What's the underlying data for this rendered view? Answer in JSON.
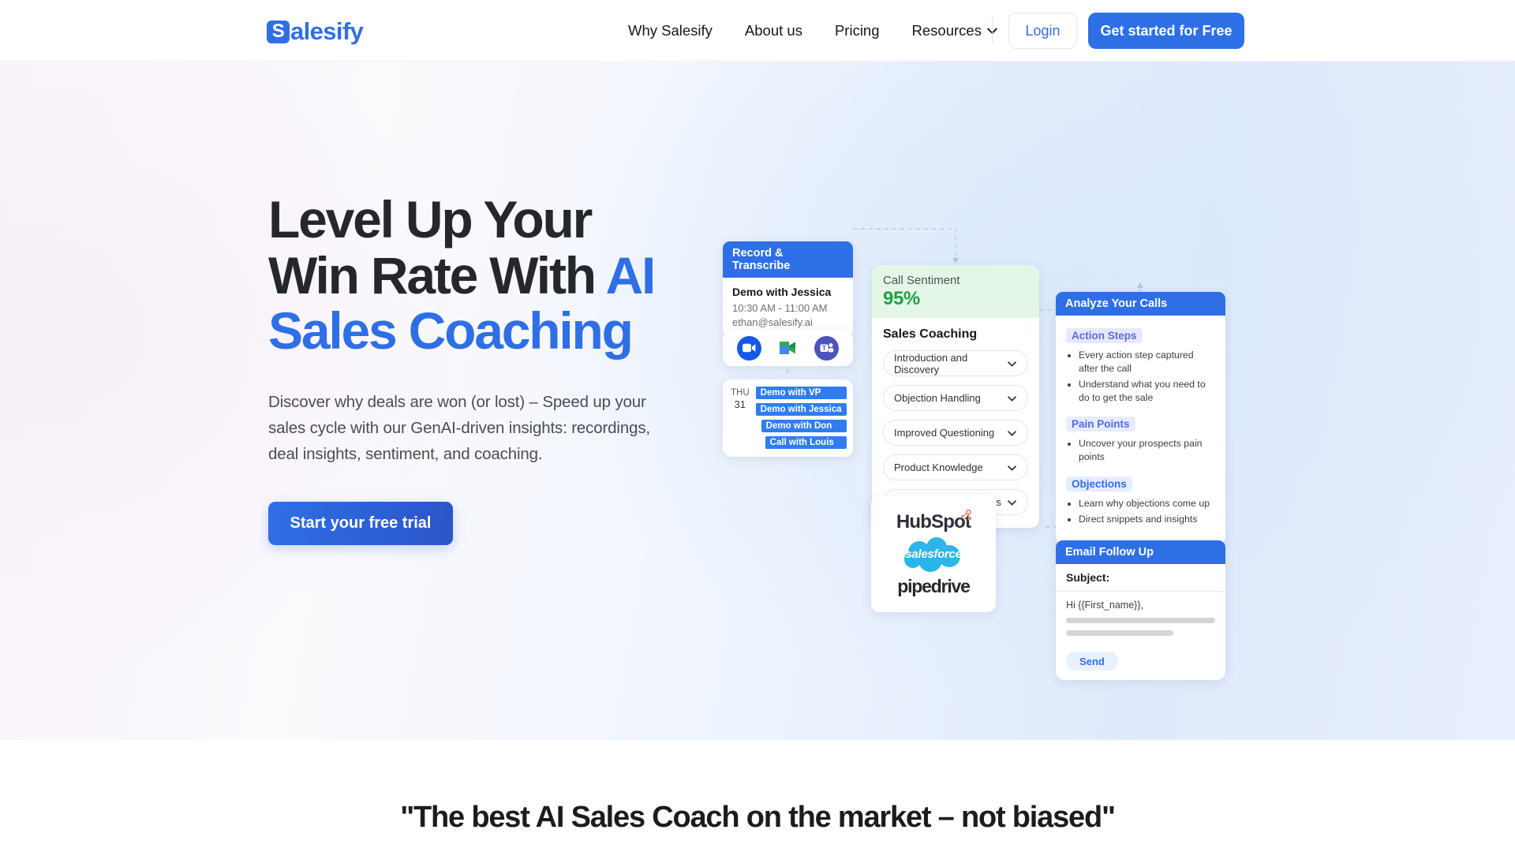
{
  "brand": {
    "name_mark": "S",
    "name_rest": "alesify",
    "accent_color": "#2f6fe6"
  },
  "nav": {
    "links": [
      {
        "label": "Why Salesify",
        "has_caret": false
      },
      {
        "label": "About us",
        "has_caret": false
      },
      {
        "label": "Pricing",
        "has_caret": false
      },
      {
        "label": "Resources",
        "has_caret": true
      }
    ],
    "login_label": "Login",
    "cta_label": "Get started for Free"
  },
  "hero": {
    "headline_line1": "Level Up Your",
    "headline_line2": "Win Rate With ",
    "headline_accent1": "AI",
    "headline_accent2": "Sales Coaching",
    "subcopy": "Discover why deals are won (or lost) – Speed up your sales cycle with our GenAI-driven insights: recordings, deal insights, sentiment, and coaching.",
    "cta_label": "Start your free trial"
  },
  "graphic": {
    "record": {
      "header": "Record & Transcribe",
      "title": "Demo with Jessica",
      "time": "10:30 AM - 11:00 AM",
      "email": "ethan@salesify.ai",
      "icons": [
        {
          "name": "zoom-icon",
          "label": "Zoom"
        },
        {
          "name": "google-meet-icon",
          "label": "Google Meet"
        },
        {
          "name": "microsoft-teams-icon",
          "label": "Microsoft Teams"
        }
      ]
    },
    "calendar": {
      "day_of_week": "THU",
      "day_number": "31",
      "events": [
        "Demo with VP",
        "Demo with Jessica",
        "Demo with Don",
        "Call with Louis"
      ]
    },
    "sentiment": {
      "label": "Call Sentiment",
      "value": "95%",
      "value_color": "#21a047"
    },
    "coaching": {
      "title": "Sales Coaching",
      "items": [
        "Introduction and Discovery",
        "Objection Handling",
        "Improved Questioning",
        "Product Knowledge",
        "Closing and Next Steps"
      ]
    },
    "analyze": {
      "header": "Analyze Your Calls",
      "sections": [
        {
          "tag": "Action Steps",
          "bullets": [
            "Every action step captured after the call",
            "Understand what you need to do to get the sale"
          ]
        },
        {
          "tag": "Pain Points",
          "bullets": [
            "Uncover your prospects pain points"
          ]
        },
        {
          "tag": "Objections",
          "bullets": [
            "Learn why objections come up",
            "Direct snippets and insights"
          ]
        }
      ]
    },
    "crm": {
      "logos": [
        {
          "name": "hubspot-logo",
          "label": "HubSpot"
        },
        {
          "name": "salesforce-logo",
          "label": "salesforce"
        },
        {
          "name": "pipedrive-logo",
          "label": "pipedrive"
        }
      ]
    },
    "email": {
      "header": "Email Follow Up",
      "subject_label": "Subject:",
      "greeting": "Hi {{First_name}},",
      "send_label": "Send"
    }
  },
  "testimonial": {
    "quote": "\"The best AI Sales Coach on the market – not biased\""
  }
}
